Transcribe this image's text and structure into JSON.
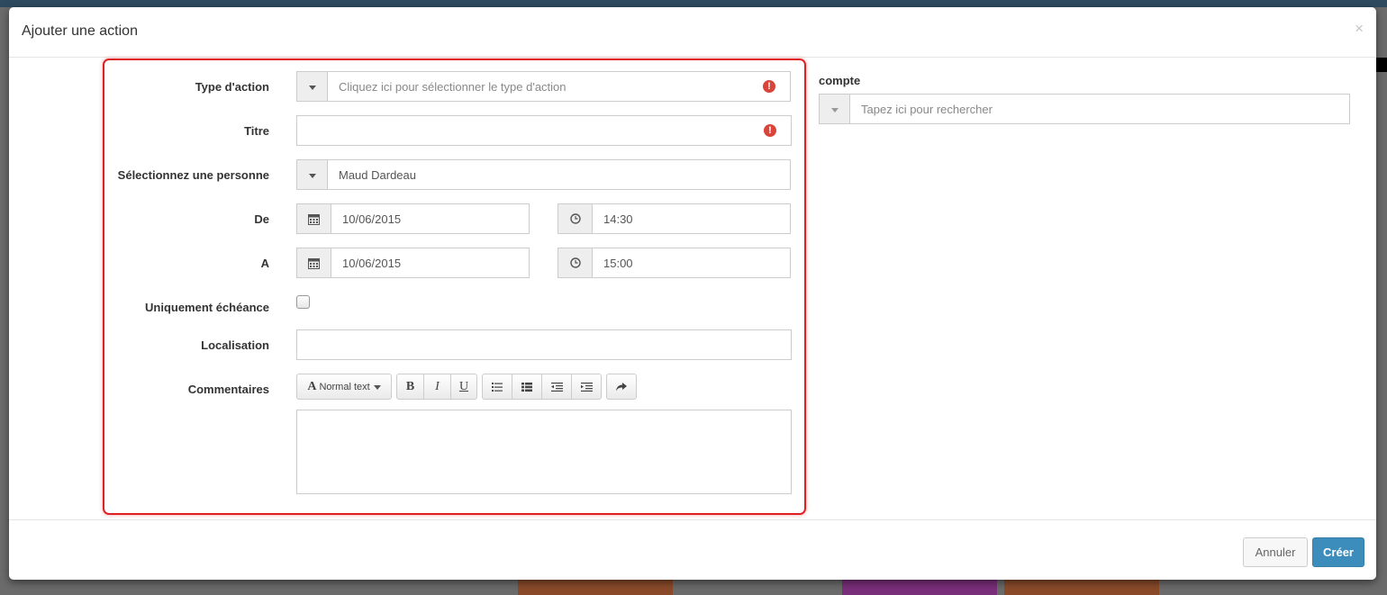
{
  "modal": {
    "title": "Ajouter une action",
    "close": "×"
  },
  "form": {
    "type_action": {
      "label": "Type d'action",
      "placeholder": "Cliquez ici pour sélectionner le type d'action"
    },
    "titre": {
      "label": "Titre",
      "value": ""
    },
    "personne": {
      "label": "Sélectionnez une personne",
      "value": "Maud Dardeau"
    },
    "de": {
      "label": "De",
      "date": "10/06/2015",
      "time": "14:30"
    },
    "a": {
      "label": "A",
      "date": "10/06/2015",
      "time": "15:00"
    },
    "echeance": {
      "label": "Uniquement échéance",
      "checked": false
    },
    "localisation": {
      "label": "Localisation",
      "value": ""
    },
    "commentaires": {
      "label": "Commentaires",
      "value": ""
    }
  },
  "toolbar": {
    "style_letter": "A",
    "style_label": "Normal text",
    "bold": "B",
    "italic": "I",
    "underline": "U"
  },
  "compte": {
    "label": "compte",
    "placeholder": "Tapez ici pour rechercher"
  },
  "footer": {
    "cancel": "Annuler",
    "create": "Créer"
  },
  "colors": {
    "primary": "#3c8dbc",
    "error": "#d9453a",
    "highlight": "#e02020"
  },
  "icons": [
    "caret-down-icon",
    "error-icon",
    "calendar-icon",
    "clock-icon",
    "list-ul-icon",
    "list-ol-icon",
    "outdent-icon",
    "indent-icon",
    "share-icon",
    "close-icon"
  ]
}
